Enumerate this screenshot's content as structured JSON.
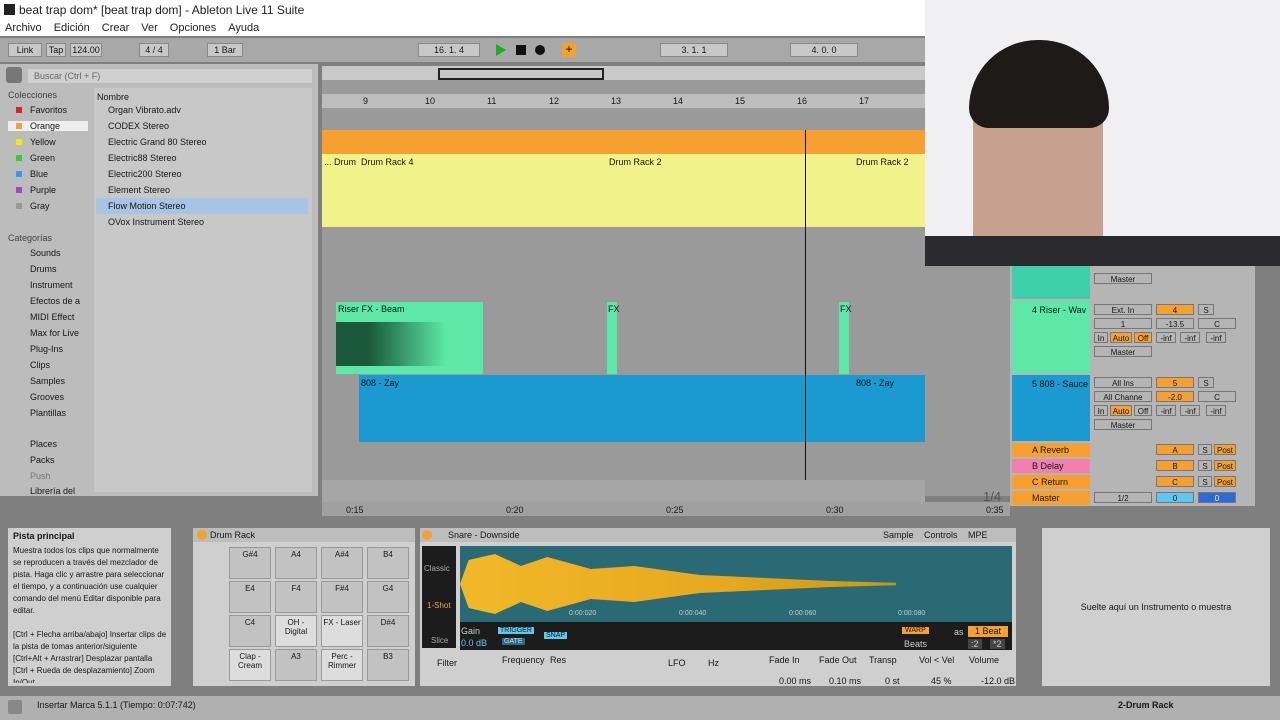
{
  "window": {
    "title": "beat trap dom* [beat trap dom] - Ableton Live 11 Suite"
  },
  "menu": [
    "Archivo",
    "Edición",
    "Crear",
    "Ver",
    "Opciones",
    "Ayuda"
  ],
  "transport": {
    "link": "Link",
    "tap": "Tap",
    "tempo": "124.00",
    "signature": "4 / 4",
    "quantize": "1 Bar",
    "position": "16. 1. 4",
    "loop_start": "3. 1. 1",
    "loop_length": "4. 0. 0"
  },
  "browser": {
    "search_placeholder": "Buscar (Ctrl + F)",
    "collections_title": "Colecciones",
    "collections": [
      "Favoritos",
      "Orange",
      "Yellow",
      "Green",
      "Blue",
      "Purple",
      "Gray"
    ],
    "categories_title": "Categorías",
    "categories": [
      "Sounds",
      "Drums",
      "Instrument",
      "Efectos de a",
      "MIDI Effect",
      "Max for Live",
      "Plug-Ins",
      "Clips",
      "Samples",
      "Grooves",
      "Plantillas"
    ],
    "places": [
      "Places",
      "Packs",
      "Push",
      "Librería del"
    ],
    "name_header": "Nombre",
    "files": [
      "Organ Vibrato.adv",
      "CODEX Stereo",
      "Electric Grand 80 Stereo",
      "Electric88 Stereo",
      "Electric200 Stereo",
      "Element Stereo",
      "Flow Motion Stereo",
      "OVox Instrument Stereo"
    ]
  },
  "ruler": {
    "bars": [
      "9",
      "10",
      "11",
      "12",
      "13",
      "14",
      "15",
      "16",
      "17"
    ],
    "times": [
      "0:15",
      "0:20",
      "0:25",
      "0:30",
      "0:35"
    ]
  },
  "clips": {
    "drum1": "... Drum",
    "drum2": "Drum Rack 4",
    "drum3": "Drum Rack 2",
    "drum4": "Drum Rack 2",
    "riser1": "Riser FX - Beam",
    "riser2": "FX",
    "riser3": "FX",
    "bass1": "808 - Zay",
    "bass2": "808 - Zay"
  },
  "mixer": {
    "track4": "4 Riser - Wav",
    "track5": "5 808 - Sauce",
    "returnA": "A Reverb",
    "returnB": "B Delay",
    "returnC": "C Return",
    "master": "Master",
    "input4": "Ext. In",
    "ch4": "1",
    "route": "Master",
    "in_all": "All Ins",
    "ch_all": "All Channe",
    "in": "In",
    "auto": "Auto",
    "off": "Off",
    "num4": "4",
    "num5": "5",
    "vol4": "-13.5",
    "vol5": "-2.0",
    "c": "C",
    "inf": "-inf",
    "s": "S",
    "a": "A",
    "b": "B",
    "cc": "C",
    "post": "Post",
    "zero": "0",
    "half": "1/2",
    "fraction": "1/4"
  },
  "info": {
    "title": "Pista principal",
    "body": "Muestra todos los clips que normalmente se reproducen a través del mezclador de pista. Haga clic y arrastre para seleccionar el tiempo, y a continuación use cualquier comando del menú Editar disponible para editar.\n\n[Ctrl + Flecha arriba/abajo] Insertar clips de la pista de tomas anterior/siguiente\n[Ctrl+Alt + Arrastrar] Desplazar pantalla\n[Ctrl + Rueda de desplazamiento] Zoom In/Out"
  },
  "drumrack": {
    "title": "Drum Rack",
    "pads": [
      "G#4",
      "A4",
      "A#4",
      "B4",
      "E4",
      "F4",
      "F#4",
      "G4",
      "C4",
      "OH - Digital",
      "FX - Laser",
      "D#4",
      "Clap - Cream",
      "A3",
      "Perc - Rimmer",
      "B3"
    ],
    "m": "M",
    "s": "S"
  },
  "sampler": {
    "title": "Snare - Downside",
    "tabs": [
      "Sample",
      "Controls",
      "MPE"
    ],
    "modes": [
      "Classic",
      "1-Shot",
      "Slice"
    ],
    "gain_label": "Gain",
    "gain": "0.0 dB",
    "trigger": "TRIGGER",
    "gate": "GATE",
    "snap": "SNAP",
    "warp": "WARP",
    "as": "as",
    "beat": "1 Beat",
    "beats": "Beats",
    "x2": ":2",
    "x2b": "*2",
    "times": [
      "0:00:020",
      "0:00:040",
      "0:00:060",
      "0:00:080"
    ],
    "filter": "Filter",
    "frequency": "Frequency",
    "res": "Res",
    "lfo": "LFO",
    "hz": "Hz",
    "fadein": "Fade In",
    "fadein_val": "0.00 ms",
    "fadeout": "Fade Out",
    "fadeout_val": "0.10 ms",
    "transp": "Transp",
    "transp_val": "0 st",
    "volvel": "Vol < Vel",
    "volvel_val": "45 %",
    "volume": "Volume",
    "volume_val": "-12.0 dB"
  },
  "drop_hint": "Suelte aquí un Instrumento o muestra",
  "status": {
    "message": "Insertar Marca 5.1.1 (Tiempo: 0:07:742)",
    "track": "2-Drum Rack"
  },
  "colors": {
    "orange": "#f5a030",
    "yellow": "#f2f28a",
    "green": "#5ee8a8",
    "blue": "#1a9ad0",
    "accent": "#ffa500"
  }
}
